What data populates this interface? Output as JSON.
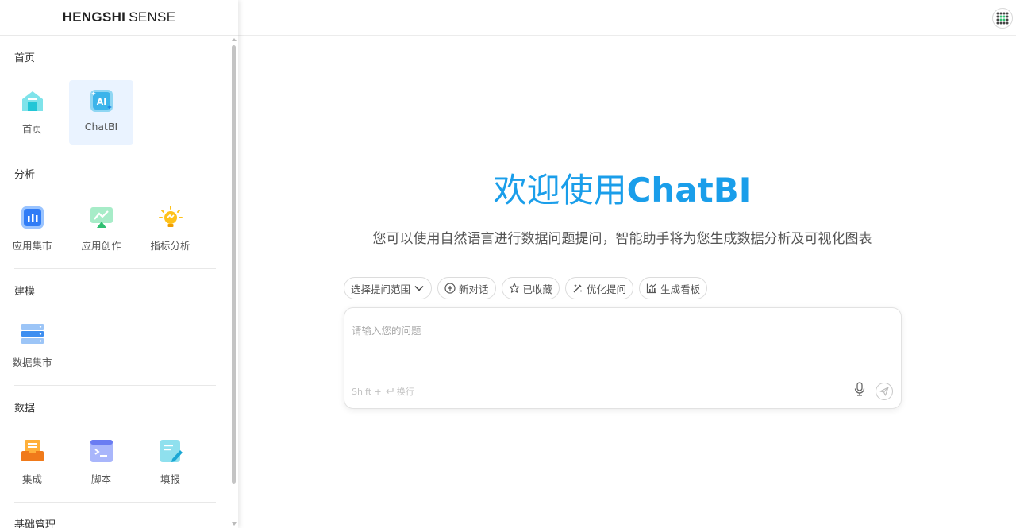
{
  "brand": {
    "bold": "HENGSHI",
    "rest": "SENSE"
  },
  "sidebar": {
    "sections": [
      {
        "title": "首页",
        "items": [
          {
            "label": "首页",
            "icon": "home-icon"
          },
          {
            "label": "ChatBI",
            "icon": "ai-icon",
            "active": true
          }
        ]
      },
      {
        "title": "分析",
        "items": [
          {
            "label": "应用集市",
            "icon": "app-market-icon"
          },
          {
            "label": "应用创作",
            "icon": "app-create-icon"
          },
          {
            "label": "指标分析",
            "icon": "bulb-icon"
          }
        ]
      },
      {
        "title": "建模",
        "items": [
          {
            "label": "数据集市",
            "icon": "data-mart-icon"
          }
        ]
      },
      {
        "title": "数据",
        "items": [
          {
            "label": "集成",
            "icon": "integration-icon"
          },
          {
            "label": "脚本",
            "icon": "script-icon"
          },
          {
            "label": "填报",
            "icon": "fill-report-icon"
          }
        ]
      },
      {
        "title": "基础管理",
        "items": []
      }
    ]
  },
  "main": {
    "welcome_prefix": "欢迎使用",
    "welcome_product": "ChatBI",
    "subtitle": "您可以使用自然语言进行数据问题提问，智能助手将为您生成数据分析及可视化图表",
    "toolbar": {
      "scope": "选择提问范围",
      "new_chat": "新对话",
      "favorites": "已收藏",
      "optimize": "优化提问",
      "dashboard": "生成看板"
    },
    "input": {
      "placeholder": "请输入您的问题",
      "hint_key": "Shift +",
      "hint_text": "换行"
    }
  },
  "colors": {
    "accent": "#1a9eea",
    "active_bg": "#eaf3ff"
  }
}
